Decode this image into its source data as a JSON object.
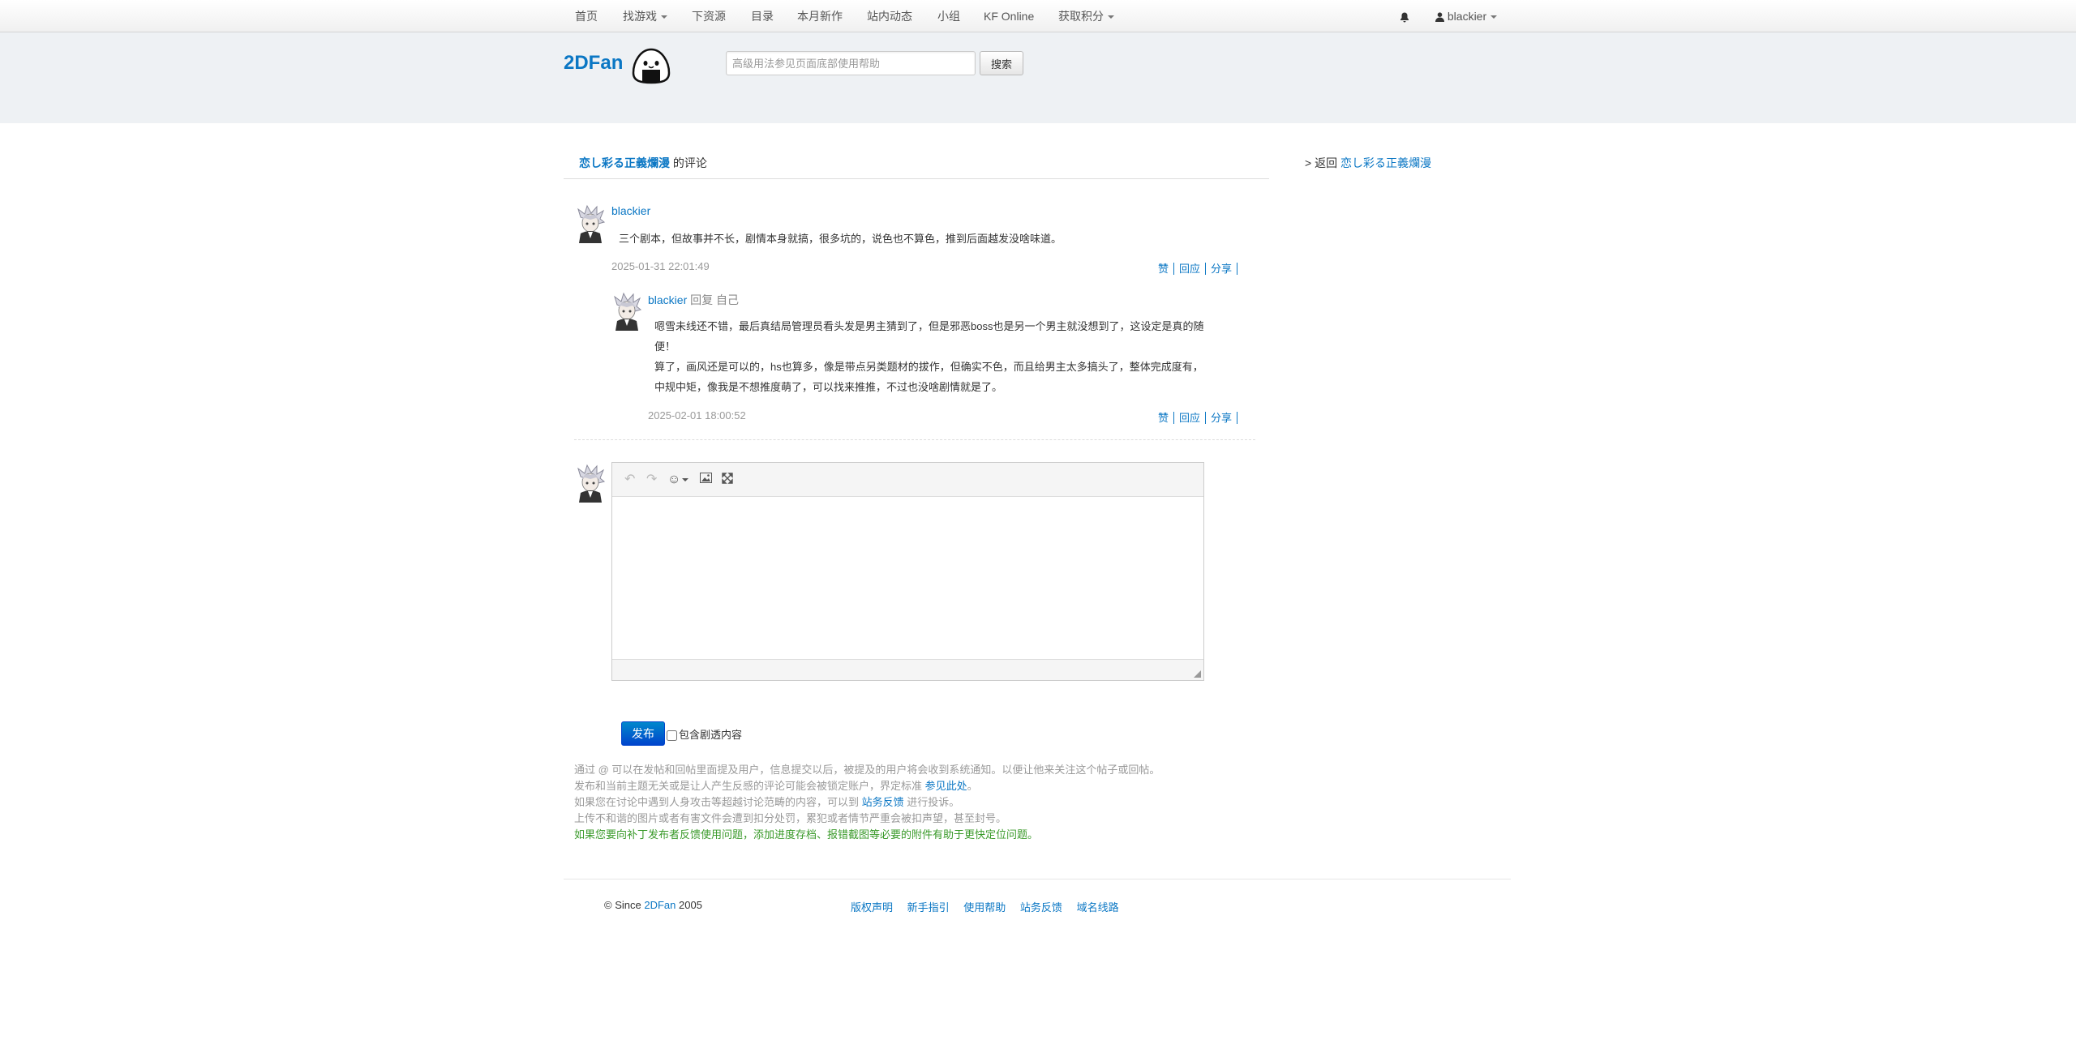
{
  "navbar": {
    "items": [
      {
        "label": "首页"
      },
      {
        "label": "找游戏"
      },
      {
        "label": "下资源"
      },
      {
        "label": "目录"
      },
      {
        "label": "本月新作"
      },
      {
        "label": "站内动态"
      },
      {
        "label": "小组"
      },
      {
        "label": "KF Online"
      },
      {
        "label": "获取积分"
      }
    ],
    "user": "blackier"
  },
  "header": {
    "brand": "2DFan",
    "search_placeholder": "高级用法参见页面底部使用帮助",
    "search_button": "搜索"
  },
  "title": {
    "game": "恋し彩る正義爛漫",
    "suffix": "的评论"
  },
  "sidebar": {
    "back_prefix": "> 返回",
    "back_link": "恋し彩る正義爛漫"
  },
  "comments": [
    {
      "user": "blackier",
      "text": [
        "三个剧本，但故事并不长，剧情本身就搞，很多坑的，说色也不算色，推到后面越发没啥味道。"
      ],
      "time": "2025-01-31 22:01:49",
      "actions": [
        "赞",
        "回应",
        "分享"
      ]
    },
    {
      "user": "blackier",
      "reply_label": "回复 自己",
      "text": [
        "嗯雪未线还不错，最后真结局管理员看头发是男主猜到了，但是邪恶boss也是另一个男主就没想到了，这设定是真的随",
        "便！",
        "算了，画风还是可以的，hs也算多，像是带点另类题材的拔作，但确实不色，而且给男主太多搞头了，整体完成度有，",
        "中规中矩，像我是不想推度萌了，可以找来推推，不过也没啥剧情就是了。"
      ],
      "time": "2025-02-01 18:00:52",
      "actions": [
        "赞",
        "回应",
        "分享"
      ]
    }
  ],
  "editor": {
    "publish_button": "发布",
    "spoiler_label": "包含剧透内容"
  },
  "notice": {
    "line1": "通过 @ 可以在发帖和回帖里面提及用户，信息提交以后，被提及的用户将会收到系统通知。以便让他来关注这个帖子或回帖。",
    "line2_prefix": "发布和当前主题无关或是让人产生反感的评论可能会被锁定账户，界定标准",
    "line2_link": "参见此处",
    "line2_suffix": "。",
    "line3_prefix": "如果您在讨论中遇到人身攻击等超越讨论范畴的内容，可以到",
    "line3_link": "站务反馈",
    "line3_suffix": "进行投诉。",
    "line4": "上传不和谐的图片或者有害文件会遭到扣分处罚，累犯或者情节严重会被扣声望，甚至封号。",
    "line5": "如果您要向补丁发布者反馈使用问题，添加进度存档、报错截图等必要的附件有助于更快定位问题。"
  },
  "footer": {
    "copyright_prefix": "© Since",
    "copyright_link": "2DFan",
    "copyright_year": "2005",
    "links": [
      "版权声明",
      "新手指引",
      "使用帮助",
      "站务反馈",
      "域名线路"
    ]
  }
}
